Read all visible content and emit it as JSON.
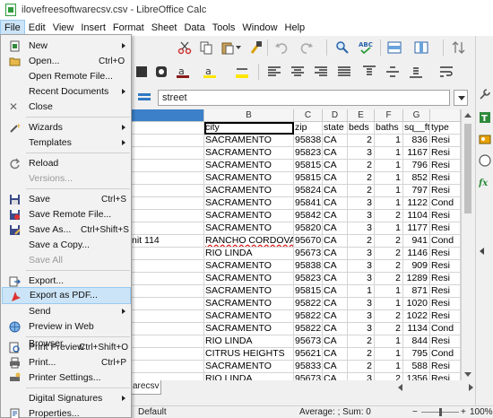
{
  "window": {
    "title": "ilovefreesoftwarecsv.csv - LibreOffice Calc"
  },
  "menubar": [
    "File",
    "Edit",
    "View",
    "Insert",
    "Format",
    "Sheet",
    "Data",
    "Tools",
    "Window",
    "Help"
  ],
  "formula": {
    "value": "street"
  },
  "columns": [
    "",
    "B",
    "C",
    "D",
    "E",
    "F",
    "G"
  ],
  "rows": [
    [
      "",
      "city",
      "zip",
      "state",
      "beds",
      "baths",
      "sq__ft",
      "type"
    ],
    [
      "",
      "SACRAMENTO",
      "95838",
      "CA",
      "2",
      "1",
      "836",
      "Resi"
    ],
    [
      "",
      "SACRAMENTO",
      "95823",
      "CA",
      "3",
      "1",
      "1167",
      "Resi"
    ],
    [
      "",
      "SACRAMENTO",
      "95815",
      "CA",
      "2",
      "1",
      "796",
      "Resi"
    ],
    [
      "",
      "SACRAMENTO",
      "95815",
      "CA",
      "2",
      "1",
      "852",
      "Resi"
    ],
    [
      "",
      "SACRAMENTO",
      "95824",
      "CA",
      "2",
      "1",
      "797",
      "Resi"
    ],
    [
      "",
      "SACRAMENTO",
      "95841",
      "CA",
      "3",
      "1",
      "1122",
      "Cond"
    ],
    [
      "",
      "SACRAMENTO",
      "95842",
      "CA",
      "3",
      "2",
      "1104",
      "Resi"
    ],
    [
      "",
      "SACRAMENTO",
      "95820",
      "CA",
      "3",
      "1",
      "1177",
      "Resi"
    ],
    [
      "nit 114",
      "RANCHO CORDOVA",
      "95670",
      "CA",
      "2",
      "2",
      "941",
      "Cond"
    ],
    [
      "",
      "RIO LINDA",
      "95673",
      "CA",
      "3",
      "2",
      "1146",
      "Resi"
    ],
    [
      "",
      "SACRAMENTO",
      "95838",
      "CA",
      "3",
      "2",
      "909",
      "Resi"
    ],
    [
      "",
      "SACRAMENTO",
      "95823",
      "CA",
      "3",
      "2",
      "1289",
      "Resi"
    ],
    [
      "",
      "SACRAMENTO",
      "95815",
      "CA",
      "1",
      "1",
      "871",
      "Resi"
    ],
    [
      "",
      "SACRAMENTO",
      "95822",
      "CA",
      "3",
      "1",
      "1020",
      "Resi"
    ],
    [
      "",
      "SACRAMENTO",
      "95822",
      "CA",
      "3",
      "2",
      "1022",
      "Resi"
    ],
    [
      "",
      "SACRAMENTO",
      "95822",
      "CA",
      "3",
      "2",
      "1134",
      "Cond"
    ],
    [
      "",
      "RIO LINDA",
      "95673",
      "CA",
      "2",
      "1",
      "844",
      "Resi"
    ],
    [
      "",
      "CITRUS HEIGHTS",
      "95621",
      "CA",
      "2",
      "1",
      "795",
      "Cond"
    ],
    [
      "",
      "SACRAMENTO",
      "95833",
      "CA",
      "2",
      "1",
      "588",
      "Resi"
    ],
    [
      "",
      "RIO LINDA",
      "95673",
      "CA",
      "3",
      "2",
      "1356",
      "Resi"
    ],
    [
      "",
      "CITRUS HEIGHTS",
      "95621",
      "CA",
      "3",
      "2",
      "1118",
      "Resi"
    ],
    [
      "",
      "SACRAMENTO",
      "95823",
      "CA",
      "4",
      "2",
      "1329",
      "Resi"
    ]
  ],
  "sheet_tab": "arecsv",
  "status": {
    "style": "Default",
    "sum": "Average: ; Sum: 0",
    "zoom": "100%"
  },
  "file_menu": {
    "new": "New",
    "open": "Open...",
    "open_sc": "Ctrl+O",
    "open_remote": "Open Remote File...",
    "recent": "Recent Documents",
    "close": "Close",
    "wizards": "Wizards",
    "templates": "Templates",
    "reload": "Reload",
    "versions": "Versions...",
    "save": "Save",
    "save_sc": "Ctrl+S",
    "save_remote": "Save Remote File...",
    "save_as": "Save As...",
    "save_as_sc": "Ctrl+Shift+S",
    "save_copy": "Save a Copy...",
    "save_all": "Save All",
    "export": "Export...",
    "export_pdf": "Export as PDF...",
    "send": "Send",
    "preview_web": "Preview in Web Browser",
    "print_preview": "Print Preview",
    "print_preview_sc": "Ctrl+Shift+O",
    "print": "Print...",
    "print_sc": "Ctrl+P",
    "printer_settings": "Printer Settings...",
    "digital_signatures": "Digital Signatures",
    "properties": "Properties..."
  }
}
